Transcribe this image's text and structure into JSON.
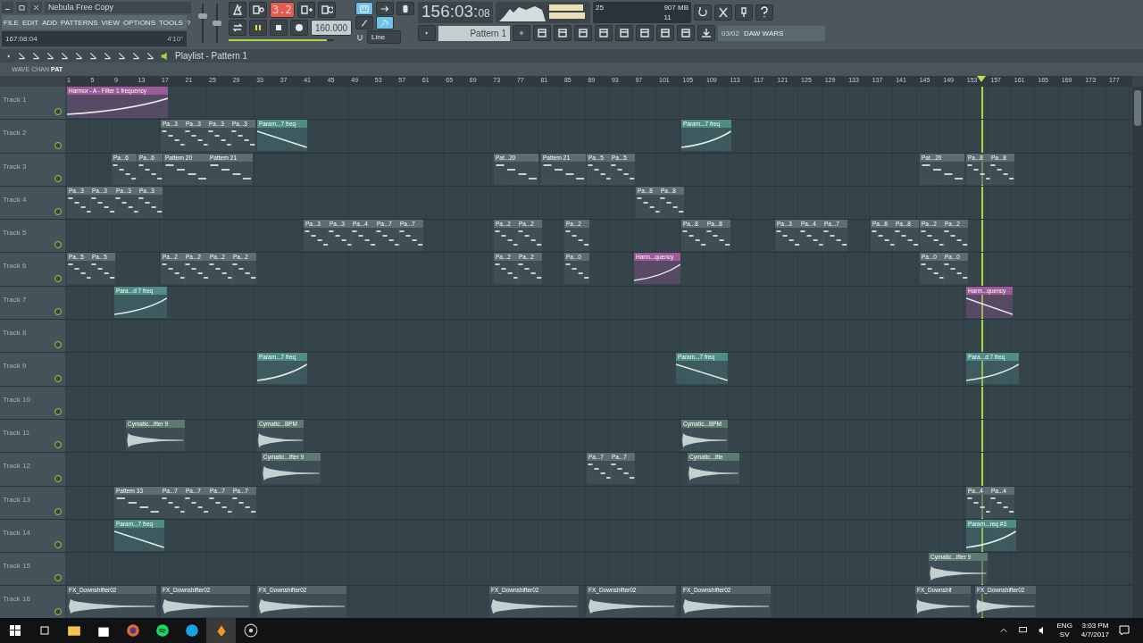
{
  "window": {
    "title": "Nebula Free Copy"
  },
  "menu": [
    "FILE",
    "EDIT",
    "ADD",
    "PATTERNS",
    "VIEW",
    "OPTIONS",
    "TOOLS",
    "?"
  ],
  "hint": {
    "position": "167:08:04",
    "length": "4'10\""
  },
  "toolbar": {
    "pattern_display": "3.2",
    "tempo": "160.000",
    "snap": "Line",
    "time_main": "156:03:",
    "time_sub": "08",
    "pattern": "Pattern 1",
    "cpu": "25",
    "memory": "907 MB",
    "polyphony": "11",
    "song_position": "03/02",
    "song_title": "DAW WARS",
    "volume_slider": {
      "level": 0.7
    },
    "pitch_slider": {
      "level": 0.5
    },
    "position_slider": {
      "level": 0.93
    }
  },
  "playlist": {
    "title": "Playlist - Pattern 1",
    "modes": [
      {
        "label": "WAVE",
        "selected": false
      },
      {
        "label": "CHAN",
        "selected": false
      },
      {
        "label": "PAT",
        "selected": true
      }
    ],
    "ruler": [
      "1",
      "5",
      "9",
      "13",
      "17",
      "21",
      "25",
      "29",
      "33",
      "37",
      "41",
      "45",
      "49",
      "53",
      "57",
      "61",
      "65",
      "69",
      "73",
      "77",
      "81",
      "85",
      "89",
      "93",
      "97",
      "101",
      "105",
      "109",
      "113",
      "117",
      "121",
      "125",
      "129",
      "133",
      "137",
      "141",
      "145",
      "149",
      "153",
      "157",
      "161",
      "165",
      "169",
      "173",
      "177"
    ],
    "tracks": [
      {
        "name": "Track 1",
        "clips": [
          {
            "label": "Harmor - A - Filter 1 frequency",
            "kind": "automation",
            "color": "#9c5a98"
          }
        ]
      },
      {
        "name": "Track 2",
        "clips": [
          {
            "label": "Pa...3",
            "kind": "pattern",
            "color": "#5f6c72"
          },
          {
            "label": "Pa...3",
            "kind": "pattern",
            "color": "#5f6c72"
          },
          {
            "label": "Pa...3",
            "kind": "pattern",
            "color": "#5f6c72"
          },
          {
            "label": "Pa...3",
            "kind": "pattern",
            "color": "#5f6c72"
          },
          {
            "label": "Param...7 freq",
            "kind": "automation",
            "color": "#4f8d86"
          },
          {
            "label": "Param...7 freq",
            "kind": "automation",
            "color": "#4f8d86"
          }
        ]
      },
      {
        "name": "Track 3",
        "clips": [
          {
            "label": "Pa...6",
            "kind": "pattern",
            "color": "#5f6c72"
          },
          {
            "label": "Pa...6",
            "kind": "pattern",
            "color": "#5f6c72"
          },
          {
            "label": "Pattern 20",
            "kind": "pattern",
            "color": "#5f6c72"
          },
          {
            "label": "Pattern 21",
            "kind": "pattern",
            "color": "#5f6c72"
          },
          {
            "label": "Pat...20",
            "kind": "pattern",
            "color": "#5f6c72"
          },
          {
            "label": "Pattern 21",
            "kind": "pattern",
            "color": "#5f6c72"
          },
          {
            "label": "Pa...5",
            "kind": "pattern",
            "color": "#5f6c72"
          },
          {
            "label": "Pa...5",
            "kind": "pattern",
            "color": "#5f6c72"
          },
          {
            "label": "Pat...20",
            "kind": "pattern",
            "color": "#5f6c72"
          },
          {
            "label": "Pa...8",
            "kind": "pattern",
            "color": "#5f6c72"
          },
          {
            "label": "Pa...8",
            "kind": "pattern",
            "color": "#5f6c72"
          }
        ]
      },
      {
        "name": "Track 4",
        "clips": [
          {
            "label": "Pa...3",
            "kind": "pattern",
            "color": "#5f6c72"
          },
          {
            "label": "Pa...3",
            "kind": "pattern",
            "color": "#5f6c72"
          },
          {
            "label": "Pa...3",
            "kind": "pattern",
            "color": "#5f6c72"
          },
          {
            "label": "Pa...3",
            "kind": "pattern",
            "color": "#5f6c72"
          },
          {
            "label": "Pa...8",
            "kind": "pattern",
            "color": "#5f6c72"
          },
          {
            "label": "Pa...8",
            "kind": "pattern",
            "color": "#5f6c72"
          }
        ]
      },
      {
        "name": "Track 5",
        "clips": [
          {
            "label": "Pa...3",
            "kind": "pattern",
            "color": "#5f6c72"
          },
          {
            "label": "Pa...3",
            "kind": "pattern",
            "color": "#5f6c72"
          },
          {
            "label": "Pa...4",
            "kind": "pattern",
            "color": "#5f6c72"
          },
          {
            "label": "Pa...7",
            "kind": "pattern",
            "color": "#5f6c72"
          },
          {
            "label": "Pa...7",
            "kind": "pattern",
            "color": "#5f6c72"
          },
          {
            "label": "Pa...2",
            "kind": "pattern",
            "color": "#5f6c72"
          },
          {
            "label": "Pa...2",
            "kind": "pattern",
            "color": "#5f6c72"
          },
          {
            "label": "Pa...2",
            "kind": "pattern",
            "color": "#5f6c72"
          },
          {
            "label": "Pa...8",
            "kind": "pattern",
            "color": "#5f6c72"
          },
          {
            "label": "Pa...8",
            "kind": "pattern",
            "color": "#5f6c72"
          },
          {
            "label": "Pa...3",
            "kind": "pattern",
            "color": "#5f6c72"
          },
          {
            "label": "Pa...4",
            "kind": "pattern",
            "color": "#5f6c72"
          },
          {
            "label": "Pa...7",
            "kind": "pattern",
            "color": "#5f6c72"
          },
          {
            "label": "Pa...8",
            "kind": "pattern",
            "color": "#5f6c72"
          },
          {
            "label": "Pa...8",
            "kind": "pattern",
            "color": "#5f6c72"
          },
          {
            "label": "Pa...2",
            "kind": "pattern",
            "color": "#5f6c72"
          },
          {
            "label": "Pa...2",
            "kind": "pattern",
            "color": "#5f6c72"
          }
        ]
      },
      {
        "name": "Track 6",
        "clips": [
          {
            "label": "Pa...5",
            "kind": "pattern",
            "color": "#5f6c72"
          },
          {
            "label": "Pa...5",
            "kind": "pattern",
            "color": "#5f6c72"
          },
          {
            "label": "Pa...2",
            "kind": "pattern",
            "color": "#5f6c72"
          },
          {
            "label": "Pa...2",
            "kind": "pattern",
            "color": "#5f6c72"
          },
          {
            "label": "Pa...2",
            "kind": "pattern",
            "color": "#5f6c72"
          },
          {
            "label": "Pa...2",
            "kind": "pattern",
            "color": "#5f6c72"
          },
          {
            "label": "Pa...2",
            "kind": "pattern",
            "color": "#5f6c72"
          },
          {
            "label": "Pa...2",
            "kind": "pattern",
            "color": "#5f6c72"
          },
          {
            "label": "Pa...0",
            "kind": "pattern",
            "color": "#5f6c72"
          },
          {
            "label": "Harm...quency",
            "kind": "automation",
            "color": "#9c5a98"
          },
          {
            "label": "Pa...0",
            "kind": "pattern",
            "color": "#5f6c72"
          },
          {
            "label": "Pa...0",
            "kind": "pattern",
            "color": "#5f6c72"
          }
        ]
      },
      {
        "name": "Track 7",
        "clips": [
          {
            "label": "Para...d 7 freq",
            "kind": "automation",
            "color": "#4f8d86"
          },
          {
            "label": "Harm...quency",
            "kind": "automation",
            "color": "#9c5a98"
          }
        ]
      },
      {
        "name": "Track 8"
      },
      {
        "name": "Track 9",
        "clips": [
          {
            "label": "Param...7 freq",
            "kind": "automation",
            "color": "#4f8d86"
          },
          {
            "label": "Param...7 freq",
            "kind": "automation",
            "color": "#4f8d86"
          },
          {
            "label": "Para...d 7 freq",
            "kind": "automation",
            "color": "#4f8d86"
          }
        ]
      },
      {
        "name": "Track 10"
      },
      {
        "name": "Track 11",
        "clips": [
          {
            "label": "Cymatic...ifter 9",
            "kind": "audio",
            "color": "#5c7a70"
          },
          {
            "label": "Cymatic...BPM",
            "kind": "audio",
            "color": "#5c7a70"
          },
          {
            "label": "Cymatic...BPM",
            "kind": "audio",
            "color": "#5c7a70"
          }
        ]
      },
      {
        "name": "Track 12",
        "clips": [
          {
            "label": "Cymatic...ifter 9",
            "kind": "audio",
            "color": "#5c7a70"
          },
          {
            "label": "Pa...7",
            "kind": "pattern",
            "color": "#5f6c72"
          },
          {
            "label": "Pa...7",
            "kind": "pattern",
            "color": "#5f6c72"
          },
          {
            "label": "Cymatic...ifte",
            "kind": "audio",
            "color": "#5c7a70"
          }
        ]
      },
      {
        "name": "Track 13",
        "clips": [
          {
            "label": "Pattern 33",
            "kind": "pattern",
            "color": "#5f6c72"
          },
          {
            "label": "Pa...7",
            "kind": "pattern",
            "color": "#5f6c72"
          },
          {
            "label": "Pa...7",
            "kind": "pattern",
            "color": "#5f6c72"
          },
          {
            "label": "Pa...7",
            "kind": "pattern",
            "color": "#5f6c72"
          },
          {
            "label": "Pa...7",
            "kind": "pattern",
            "color": "#5f6c72"
          },
          {
            "label": "Pa...4",
            "kind": "pattern",
            "color": "#5f6c72"
          },
          {
            "label": "Pa...4",
            "kind": "pattern",
            "color": "#5f6c72"
          }
        ]
      },
      {
        "name": "Track 14",
        "clips": [
          {
            "label": "Param...7 freq",
            "kind": "automation",
            "color": "#4f8d86"
          },
          {
            "label": "Param...req #3",
            "kind": "automation",
            "color": "#4f8d86"
          }
        ]
      },
      {
        "name": "Track 15",
        "clips": [
          {
            "label": "Cymatic...ifter 9",
            "kind": "audio",
            "color": "#5c7a70"
          }
        ]
      },
      {
        "name": "Track 16",
        "clips": [
          {
            "label": "FX_Downshifter02",
            "kind": "audio",
            "color": "#55646b"
          },
          {
            "label": "FX_Downshifter02",
            "kind": "audio",
            "color": "#55646b"
          },
          {
            "label": "FX_Downshifter02",
            "kind": "audio",
            "color": "#55646b"
          },
          {
            "label": "FX_Downshifter02",
            "kind": "audio",
            "color": "#55646b"
          },
          {
            "label": "FX_Downshifter02",
            "kind": "audio",
            "color": "#55646b"
          },
          {
            "label": "FX_Downshifter02",
            "kind": "audio",
            "color": "#55646b"
          },
          {
            "label": "FX_Downshif",
            "kind": "audio",
            "color": "#55646b"
          },
          {
            "label": "FX_Downshifter02",
            "kind": "audio",
            "color": "#55646b"
          }
        ]
      }
    ]
  },
  "taskbar": {
    "language": "ENG",
    "layout": "SV",
    "time": "3:03 PM",
    "date": "4/7/2017"
  }
}
